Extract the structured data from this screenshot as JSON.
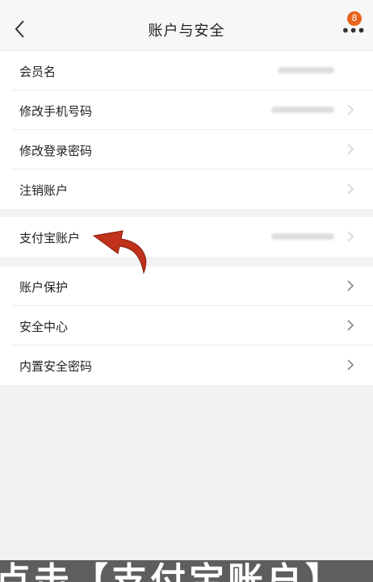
{
  "header": {
    "title": "账户与安全",
    "back_icon": "chevron-left-icon",
    "more_icon": "more-dots-icon",
    "badge_count": "8",
    "accent": "#e8641c"
  },
  "group1": [
    {
      "label": "会员名"
    },
    {
      "label": "修改手机号码"
    },
    {
      "label": "修改登录密码"
    },
    {
      "label": "注销账户"
    }
  ],
  "group2": [
    {
      "label": "支付宝账户"
    }
  ],
  "group3": [
    {
      "label": "账户保护"
    },
    {
      "label": "安全中心"
    },
    {
      "label": "内置安全密码"
    }
  ],
  "annotation": {
    "icon": "red-curved-arrow-icon",
    "color": "#c0321a"
  },
  "caption": "点击【支付宝账户】"
}
